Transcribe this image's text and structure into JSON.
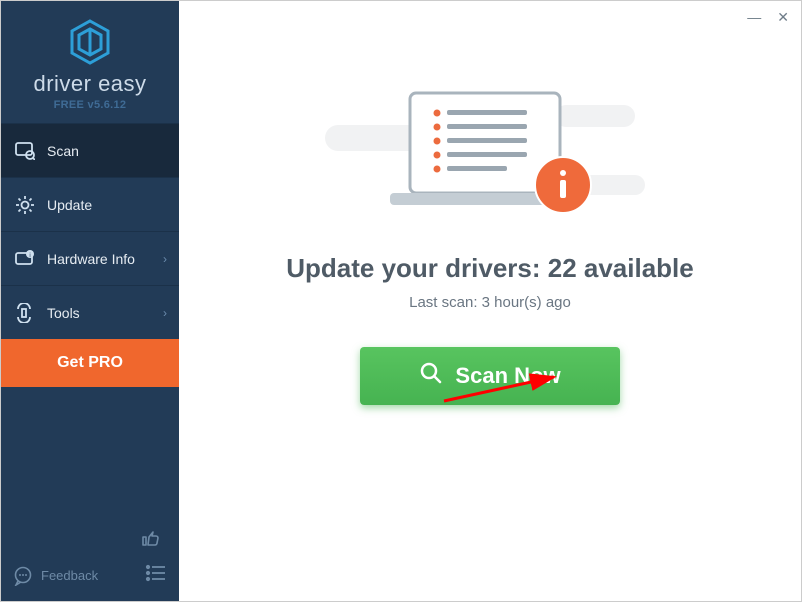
{
  "app": {
    "name": "driver easy",
    "version_line": "FREE v5.6.12"
  },
  "nav": {
    "scan": "Scan",
    "update": "Update",
    "hardware": "Hardware Info",
    "tools": "Tools"
  },
  "cta": {
    "get_pro": "Get PRO"
  },
  "footer": {
    "feedback": "Feedback"
  },
  "main": {
    "headline": "Update your drivers: 22 available",
    "subline": "Last scan: 3 hour(s) ago",
    "scan_btn": "Scan Now"
  },
  "drivers_available": 22,
  "last_scan_hours": 3
}
